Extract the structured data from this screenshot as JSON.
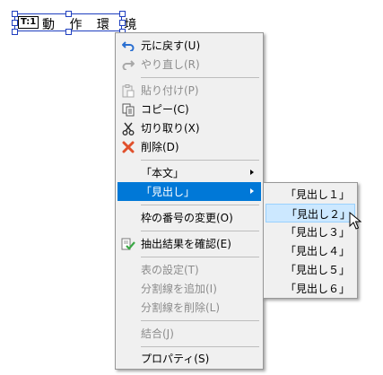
{
  "canvas": {
    "frame_tag": "T:1",
    "frame_text": "動 作 環 境"
  },
  "context_menu": {
    "items": [
      {
        "label": "元に戻す(U)",
        "icon": "undo-icon",
        "enabled": true
      },
      {
        "label": "やり直し(R)",
        "icon": "redo-icon",
        "enabled": false
      },
      {
        "label": "貼り付け(P)",
        "icon": "paste-icon",
        "enabled": false
      },
      {
        "label": "コピー(C)",
        "icon": "copy-icon",
        "enabled": true
      },
      {
        "label": "切り取り(X)",
        "icon": "cut-icon",
        "enabled": true
      },
      {
        "label": "削除(D)",
        "icon": "delete-icon",
        "enabled": true
      },
      {
        "label": "「本文」",
        "enabled": true,
        "has_submenu": true
      },
      {
        "label": "「見出し」",
        "enabled": true,
        "has_submenu": true,
        "selected": true
      },
      {
        "label": "枠の番号の変更(O)",
        "enabled": true
      },
      {
        "label": "抽出結果を確認(E)",
        "icon": "check-extract-icon",
        "enabled": true
      },
      {
        "label": "表の設定(T)",
        "enabled": false
      },
      {
        "label": "分割線を追加(I)",
        "enabled": false
      },
      {
        "label": "分割線を削除(L)",
        "enabled": false
      },
      {
        "label": "結合(J)",
        "enabled": false
      },
      {
        "label": "プロパティ(S)",
        "enabled": true
      }
    ]
  },
  "submenu": {
    "items": [
      {
        "label": "「見出し１」"
      },
      {
        "label": "「見出し２」",
        "hovered": true
      },
      {
        "label": "「見出し３」"
      },
      {
        "label": "「見出し４」"
      },
      {
        "label": "「見出し５」"
      },
      {
        "label": "「見出し６」"
      }
    ]
  },
  "colors": {
    "selection": "#0078d7",
    "hover": "#cce8ff",
    "frame_border": "#1f3fbf",
    "delete_icon": "#e0502c",
    "undo_icon": "#2a6fd1",
    "check_icon": "#3aa845"
  }
}
